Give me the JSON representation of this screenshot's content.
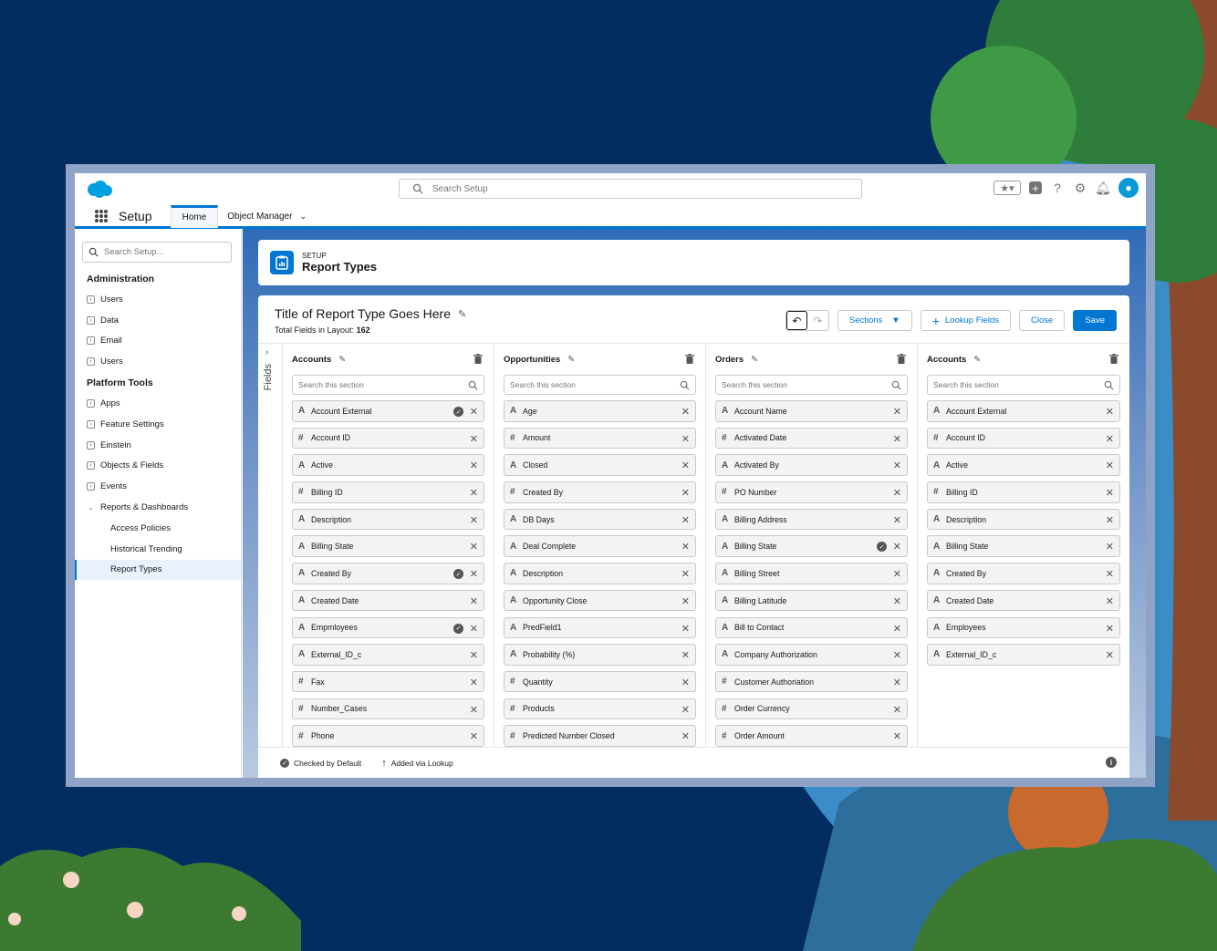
{
  "colors": {
    "brand": "#0176d3",
    "background": "#032d60"
  },
  "search": {
    "placeholder": "Search Setup"
  },
  "nav": {
    "app_name": "Setup",
    "tab_home": "Home",
    "tab_object_manager": "Object Manager"
  },
  "sidebar": {
    "search_placeholder": "Search Setup...",
    "admin_heading": "Administration",
    "admin_items": [
      "Users",
      "Data",
      "Email",
      "Users"
    ],
    "platform_heading": "Platform Tools",
    "platform_items": [
      "Apps",
      "Feature Settings",
      "Einstein",
      "Objects & Fields",
      "Events",
      "Reports & Dashboards"
    ],
    "sub_items": [
      "Access Policies",
      "Historical Trending",
      "Report Types"
    ]
  },
  "header": {
    "eyebrow": "SETUP",
    "title": "Report Types"
  },
  "report": {
    "title": "Title of Report Type Goes Here",
    "total_label": "Total Fields in Layout:",
    "total_value": "162",
    "sections_button": "Sections",
    "lookup_button": "Lookup Fields",
    "close_button": "Close",
    "save_button": "Save",
    "fields_rail_label": "Fields",
    "section_search_placeholder": "Search this section"
  },
  "columns": [
    {
      "title": "Accounts",
      "fields": [
        {
          "type": "A",
          "label": "Account External",
          "checked": true
        },
        {
          "type": "#",
          "label": "Account ID",
          "checked": false
        },
        {
          "type": "A",
          "label": "Active",
          "checked": false
        },
        {
          "type": "#",
          "label": "Billing ID",
          "checked": false
        },
        {
          "type": "A",
          "label": "Description",
          "checked": false
        },
        {
          "type": "A",
          "label": "Billing State",
          "checked": false
        },
        {
          "type": "A",
          "label": "Created By",
          "checked": true
        },
        {
          "type": "A",
          "label": "Created Date",
          "checked": false
        },
        {
          "type": "A",
          "label": "Empmloyees",
          "checked": true
        },
        {
          "type": "A",
          "label": "External_ID_c",
          "checked": false
        },
        {
          "type": "#",
          "label": "Fax",
          "checked": false
        },
        {
          "type": "#",
          "label": "Number_Cases",
          "checked": false
        },
        {
          "type": "#",
          "label": "Phone",
          "checked": false
        }
      ]
    },
    {
      "title": "Opportunities",
      "fields": [
        {
          "type": "A",
          "label": "Age",
          "checked": false
        },
        {
          "type": "#",
          "label": "Amount",
          "checked": false
        },
        {
          "type": "A",
          "label": "Closed",
          "checked": false
        },
        {
          "type": "#",
          "label": "Created By",
          "checked": false
        },
        {
          "type": "A",
          "label": "DB Days",
          "checked": false
        },
        {
          "type": "A",
          "label": "Deal Complete",
          "checked": false
        },
        {
          "type": "A",
          "label": "Description",
          "checked": false
        },
        {
          "type": "A",
          "label": "Opportunity Close",
          "checked": false
        },
        {
          "type": "A",
          "label": "PredField1",
          "checked": false
        },
        {
          "type": "A",
          "label": "Probability (%)",
          "checked": false
        },
        {
          "type": "#",
          "label": "Quantity",
          "checked": false
        },
        {
          "type": "#",
          "label": "Products",
          "checked": false
        },
        {
          "type": "#",
          "label": "Predicted Number Closed",
          "checked": false
        }
      ]
    },
    {
      "title": "Orders",
      "fields": [
        {
          "type": "A",
          "label": "Account Name",
          "checked": false
        },
        {
          "type": "#",
          "label": "Activated Date",
          "checked": false
        },
        {
          "type": "A",
          "label": "Activated By",
          "checked": false
        },
        {
          "type": "#",
          "label": "PO Number",
          "checked": false
        },
        {
          "type": "A",
          "label": "Billing Address",
          "checked": false
        },
        {
          "type": "A",
          "label": "Billing State",
          "checked": true
        },
        {
          "type": "A",
          "label": "Billing Street",
          "checked": false
        },
        {
          "type": "A",
          "label": "Billing Latitude",
          "checked": false
        },
        {
          "type": "A",
          "label": "Bill to Contact",
          "checked": false
        },
        {
          "type": "A",
          "label": "Company Authorization",
          "checked": false
        },
        {
          "type": "#",
          "label": "Customer Authoriation",
          "checked": false
        },
        {
          "type": "#",
          "label": "Order Currency",
          "checked": false
        },
        {
          "type": "#",
          "label": "Order Amount",
          "checked": false
        }
      ]
    },
    {
      "title": "Accounts",
      "fields": [
        {
          "type": "A",
          "label": "Account External",
          "checked": false
        },
        {
          "type": "#",
          "label": "Account ID",
          "checked": false
        },
        {
          "type": "A",
          "label": "Active",
          "checked": false
        },
        {
          "type": "#",
          "label": "Billing ID",
          "checked": false
        },
        {
          "type": "A",
          "label": "Description",
          "checked": false
        },
        {
          "type": "A",
          "label": "Billing State",
          "checked": false
        },
        {
          "type": "A",
          "label": "Created By",
          "checked": false
        },
        {
          "type": "A",
          "label": "Created Date",
          "checked": false
        },
        {
          "type": "A",
          "label": "Employees",
          "checked": false
        },
        {
          "type": "A",
          "label": "External_ID_c",
          "checked": false
        }
      ]
    }
  ],
  "legend": {
    "checked_default": "Checked by Default",
    "added_lookup": "Added via Lookup"
  }
}
